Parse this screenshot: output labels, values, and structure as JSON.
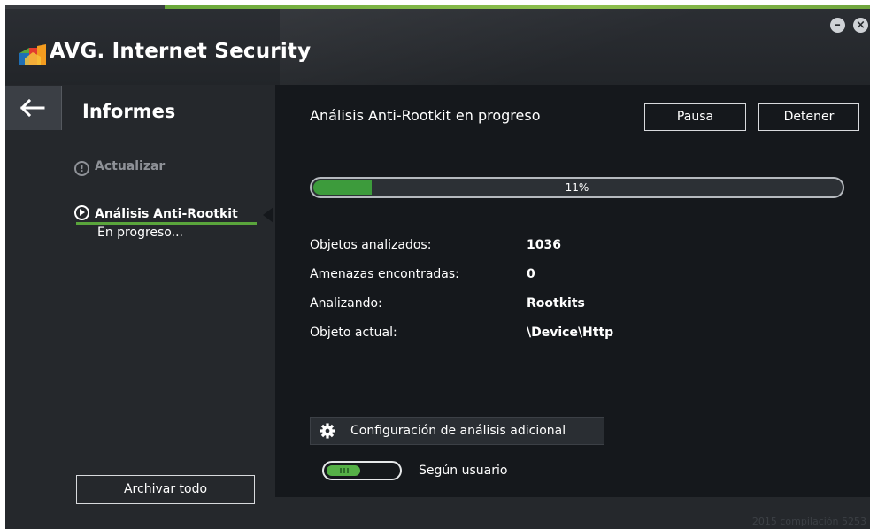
{
  "app": {
    "title": "AVG. Internet Security",
    "minimize_glyph": "–",
    "close_glyph": "×",
    "build": "2015  compilación 5253"
  },
  "sidebar": {
    "section_title": "Informes",
    "refresh_label": "Actualizar",
    "scan_item": {
      "label": "Análisis Anti-Rootkit",
      "status": "En progreso..."
    },
    "archive_label": "Archivar todo"
  },
  "main": {
    "title": "Análisis Anti-Rootkit en progreso",
    "pause_label": "Pausa",
    "stop_label": "Detener",
    "progress": {
      "percent": 11,
      "label": "11%"
    },
    "stats": [
      {
        "label": "Objetos analizados:",
        "value": "1036"
      },
      {
        "label": "Amenazas encontradas:",
        "value": "0"
      },
      {
        "label": "Analizando:",
        "value": "Rootkits"
      },
      {
        "label": "Objeto actual:",
        "value": "\\Device\\Http"
      }
    ],
    "settings_label": "Configuración de análisis adicional",
    "toggle": {
      "on": true,
      "label": "Según usuario"
    }
  },
  "colors": {
    "accent_green": "#3d9b3c",
    "panel_dark": "#15181c",
    "sidebar_bg": "#25282c"
  },
  "icons": {
    "logo": "avg-logo-icon",
    "back": "arrow-left-icon",
    "refresh": "exclamation-circle-icon",
    "scan": "play-circle-icon",
    "settings": "gear-icon"
  }
}
